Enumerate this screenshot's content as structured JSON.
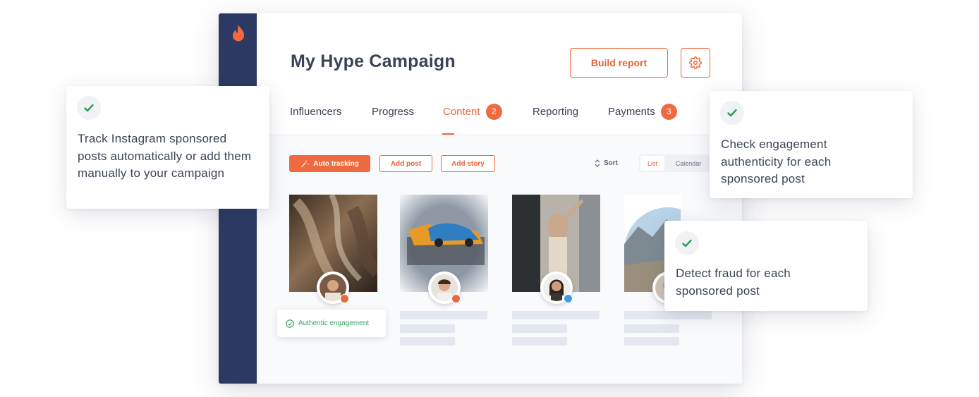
{
  "campaign": {
    "title": "My Hype Campaign",
    "build_report_label": "Build report"
  },
  "tabs": [
    {
      "label": "Influencers"
    },
    {
      "label": "Progress"
    },
    {
      "label": "Content",
      "badge": "2",
      "active": true
    },
    {
      "label": "Reporting"
    },
    {
      "label": "Payments",
      "badge": "3"
    }
  ],
  "toolbar": {
    "auto_tracking_label": "Auto tracking",
    "add_post_label": "Add post",
    "add_story_label": "Add story",
    "sort_label": "Sort",
    "view_list_label": "List",
    "view_calendar_label": "Calendar"
  },
  "posts": [
    {
      "network": "instagram-icon"
    },
    {
      "network": "youtube-icon"
    },
    {
      "network": "twitter-icon"
    },
    {
      "network": "instagram-icon"
    }
  ],
  "authentic_chip": "Authentic engagement",
  "callouts": {
    "track": "Track Instagram sponsored posts automatically or add them manually to your campaign",
    "engagement": "Check engagement authenticity for each sponsored post",
    "fraud": "Detect fraud for each sponsored post"
  },
  "colors": {
    "accent": "#ef6a3e",
    "sidebar": "#2c3a63",
    "success": "#3aa55e"
  }
}
